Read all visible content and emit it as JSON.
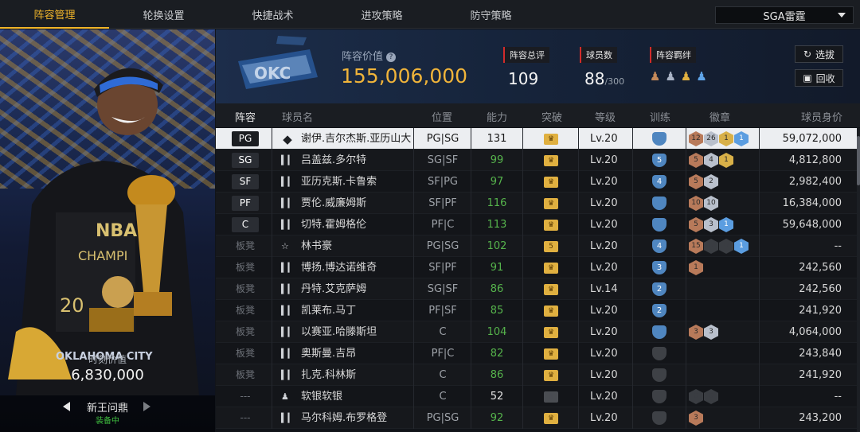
{
  "tabs": [
    "阵容管理",
    "轮换设置",
    "快捷战术",
    "进攻策略",
    "防守策略"
  ],
  "active_tab": 0,
  "team_select": "SGA雷霆",
  "card": {
    "mv_label": "时刻价值",
    "mv_value": "6,830,000",
    "skin_name": "新王问鼎",
    "equipped": "装备中"
  },
  "header": {
    "value_label": "阵容价值",
    "value": "155,006,000",
    "rating_label": "阵容总评",
    "rating": "109",
    "count_label": "球员数",
    "count": "88",
    "count_max": "/300",
    "bond_label": "阵容羁绊",
    "btn_select": "选拔",
    "btn_recycle": "回收"
  },
  "columns": {
    "slot": "阵容",
    "name": "球员名",
    "position": "位置",
    "ability": "能力",
    "breakthrough": "突破",
    "level": "等级",
    "training": "训练",
    "badges": "徽章",
    "value": "球员身价"
  },
  "rows": [
    {
      "slot": "PG",
      "icon": "diamond-icon",
      "name": "谢伊.吉尔杰斯.亚历山大",
      "position": "PG|SG",
      "ability": "131",
      "crown": "gold",
      "level": "Lv.20",
      "train": "",
      "badges": [
        [
          "b",
          "12"
        ],
        [
          "s",
          "26"
        ],
        [
          "g",
          "1"
        ],
        [
          "p",
          "1"
        ]
      ],
      "value": "59,072,000"
    },
    {
      "slot": "SG",
      "icon": "bars-icon",
      "name": "吕盖兹.多尔特",
      "position": "SG|SF",
      "ability": "99",
      "crown": "gold",
      "level": "Lv.20",
      "train": "5",
      "badges": [
        [
          "b",
          "5"
        ],
        [
          "s",
          "4"
        ],
        [
          "g",
          "1"
        ]
      ],
      "value": "4,812,800"
    },
    {
      "slot": "SF",
      "icon": "bars-icon",
      "name": "亚历克斯.卡鲁索",
      "position": "SF|PG",
      "ability": "97",
      "crown": "gold",
      "level": "Lv.20",
      "train": "4",
      "badges": [
        [
          "b",
          "5"
        ],
        [
          "s",
          "2"
        ]
      ],
      "value": "2,982,400"
    },
    {
      "slot": "PF",
      "icon": "bars-icon",
      "name": "贾伦.威廉姆斯",
      "position": "SF|PF",
      "ability": "116",
      "crown": "gold",
      "level": "Lv.20",
      "train": "",
      "badges": [
        [
          "b",
          "10"
        ],
        [
          "s",
          "10"
        ]
      ],
      "value": "16,384,000"
    },
    {
      "slot": "C",
      "icon": "bars-icon",
      "name": "切特.霍姆格伦",
      "position": "PF|C",
      "ability": "113",
      "crown": "gold",
      "level": "Lv.20",
      "train": "",
      "badges": [
        [
          "b",
          "5"
        ],
        [
          "s",
          "3"
        ],
        [
          "p",
          "1"
        ]
      ],
      "value": "59,648,000"
    },
    {
      "slot": "板凳",
      "icon": "star-icon",
      "name": "林书豪",
      "position": "PG|SG",
      "ability": "102",
      "crown": "gold5",
      "level": "Lv.20",
      "train": "4",
      "badges": [
        [
          "b",
          "15"
        ],
        [
          "d",
          "0"
        ],
        [
          "d",
          "0"
        ],
        [
          "p",
          "1"
        ]
      ],
      "value": "--"
    },
    {
      "slot": "板凳",
      "icon": "bars-icon",
      "name": "博扬.博达诺维奇",
      "position": "SF|PF",
      "ability": "91",
      "crown": "gold",
      "level": "Lv.20",
      "train": "3",
      "badges": [
        [
          "b",
          "1"
        ]
      ],
      "value": "242,560"
    },
    {
      "slot": "板凳",
      "icon": "bars-icon",
      "name": "丹特.艾克萨姆",
      "position": "SG|SF",
      "ability": "86",
      "crown": "gold",
      "level": "Lv.14",
      "train": "2",
      "badges": [],
      "value": "242,560"
    },
    {
      "slot": "板凳",
      "icon": "bars-icon",
      "name": "凯莱布.马丁",
      "position": "PF|SF",
      "ability": "85",
      "crown": "gold",
      "level": "Lv.20",
      "train": "2",
      "badges": [],
      "value": "241,920"
    },
    {
      "slot": "板凳",
      "icon": "bars-icon",
      "name": "以赛亚.哈滕斯坦",
      "position": "C",
      "ability": "104",
      "crown": "gold",
      "level": "Lv.20",
      "train": "",
      "badges": [
        [
          "b",
          "3"
        ],
        [
          "s",
          "3"
        ]
      ],
      "value": "4,064,000"
    },
    {
      "slot": "板凳",
      "icon": "bars-icon",
      "name": "奥斯曼.吉昂",
      "position": "PF|C",
      "ability": "82",
      "crown": "gold",
      "level": "Lv.20",
      "train": "grey",
      "badges": [],
      "value": "243,840"
    },
    {
      "slot": "板凳",
      "icon": "bars-icon",
      "name": "扎克.科林斯",
      "position": "C",
      "ability": "86",
      "crown": "gold",
      "level": "Lv.20",
      "train": "grey",
      "badges": [],
      "value": "241,920"
    },
    {
      "slot": "---",
      "icon": "person-icon",
      "name": "软银软银",
      "position": "C",
      "ability": "52",
      "crown": "dark",
      "level": "Lv.20",
      "train": "grey",
      "badges": [
        [
          "d",
          "0"
        ],
        [
          "d",
          "0"
        ]
      ],
      "value": "--"
    },
    {
      "slot": "---",
      "icon": "bars-icon",
      "name": "马尔科姆.布罗格登",
      "position": "PG|SG",
      "ability": "92",
      "crown": "gold",
      "level": "Lv.20",
      "train": "grey",
      "badges": [
        [
          "b",
          "3"
        ]
      ],
      "value": "243,200"
    }
  ]
}
